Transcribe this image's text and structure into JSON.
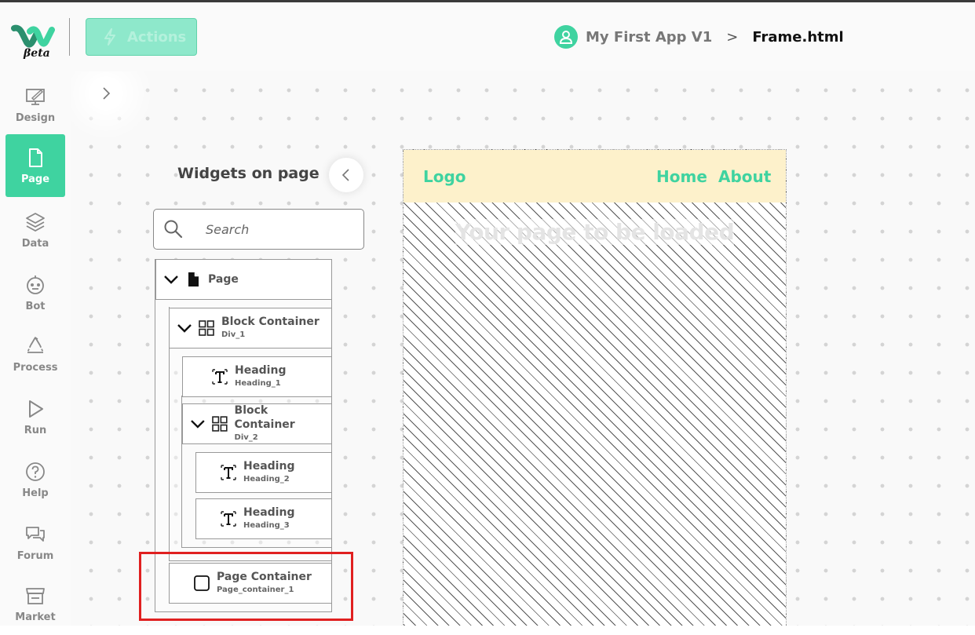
{
  "brand": {
    "beta_label": "βeta",
    "accent": "#3fd3a0"
  },
  "toolbar": {
    "actions_label": "Actions"
  },
  "breadcrumb": {
    "app_name": "My First App V1",
    "separator": ">",
    "file_name": "Frame.html"
  },
  "sidebar": {
    "items": [
      {
        "label": "Design",
        "icon": "design-icon"
      },
      {
        "label": "Page",
        "icon": "page-icon",
        "active": true
      },
      {
        "label": "Data",
        "icon": "data-icon"
      },
      {
        "label": "Bot",
        "icon": "bot-icon"
      },
      {
        "label": "Process",
        "icon": "process-icon"
      },
      {
        "label": "Run",
        "icon": "run-icon"
      },
      {
        "label": "Help",
        "icon": "help-icon"
      },
      {
        "label": "Forum",
        "icon": "forum-icon"
      },
      {
        "label": "Market",
        "icon": "market-icon"
      }
    ]
  },
  "widgets_panel": {
    "title": "Widgets on page",
    "search_placeholder": "Search",
    "tree": [
      {
        "label": "Page",
        "sub": ""
      },
      {
        "label": "Block Container",
        "sub": "Div_1"
      },
      {
        "label": "Heading",
        "sub": "Heading_1"
      },
      {
        "label": "Block Container",
        "sub": "Div_2"
      },
      {
        "label": "Heading",
        "sub": "Heading_2"
      },
      {
        "label": "Heading",
        "sub": "Heading_3"
      },
      {
        "label": "Page Container",
        "sub": "Page_container_1"
      }
    ]
  },
  "preview": {
    "logo": "Logo",
    "nav_home": "Home",
    "nav_about": "About",
    "loading_text": "Your page to be loaded",
    "nav_bg": "#fdf1cb"
  }
}
